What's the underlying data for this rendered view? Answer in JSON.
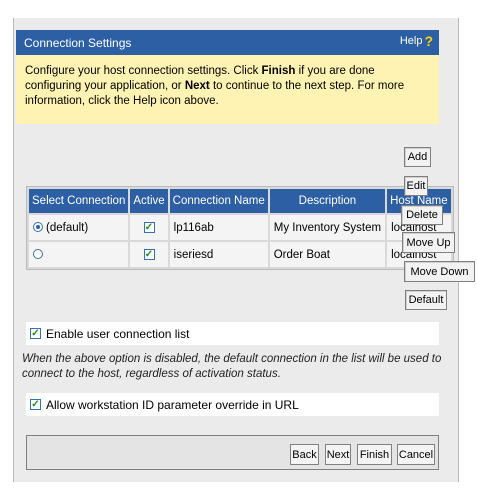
{
  "panel": {
    "title": "Connection Settings",
    "help_label": "Help",
    "help_icon": "question-mark-icon"
  },
  "intro": {
    "text_1": "Configure your host connection settings. Click ",
    "finish": "Finish",
    "text_2": " if you are done configuring your application, or ",
    "next": "Next",
    "text_3": " to continue to the next step. For more information, click the Help icon above."
  },
  "table": {
    "headers": [
      "Select Connection",
      "Active",
      "Connection Name",
      "Description",
      "Host Name"
    ],
    "rows": [
      {
        "select_label": "(default)",
        "selected": true,
        "active": true,
        "name": "lp116ab",
        "description": "My Inventory System",
        "host": "localhost"
      },
      {
        "select_label": "",
        "selected": false,
        "active": true,
        "name": "iseriesd",
        "description": "Order Boat",
        "host": "localhost"
      }
    ]
  },
  "side_buttons": {
    "add": "Add",
    "edit": "Edit",
    "delete": "Delete",
    "move_up": "Move Up",
    "move_down": "Move Down",
    "default": "Default"
  },
  "options": {
    "enable_user_list": {
      "label": "Enable user connection list",
      "checked": true
    },
    "note": "When the above option is disabled, the default connection in the list will be used to connect to the host, regardless of activation status.",
    "allow_workstation_id": {
      "label": "Allow workstation ID parameter override in URL",
      "checked": true
    }
  },
  "footer": {
    "back": "Back",
    "next": "Next",
    "finish": "Finish",
    "cancel": "Cancel"
  },
  "colors": {
    "header_blue": "#2c5fa3",
    "intro_yellow": "#fff3b3",
    "check_green": "#1d8a1d"
  }
}
